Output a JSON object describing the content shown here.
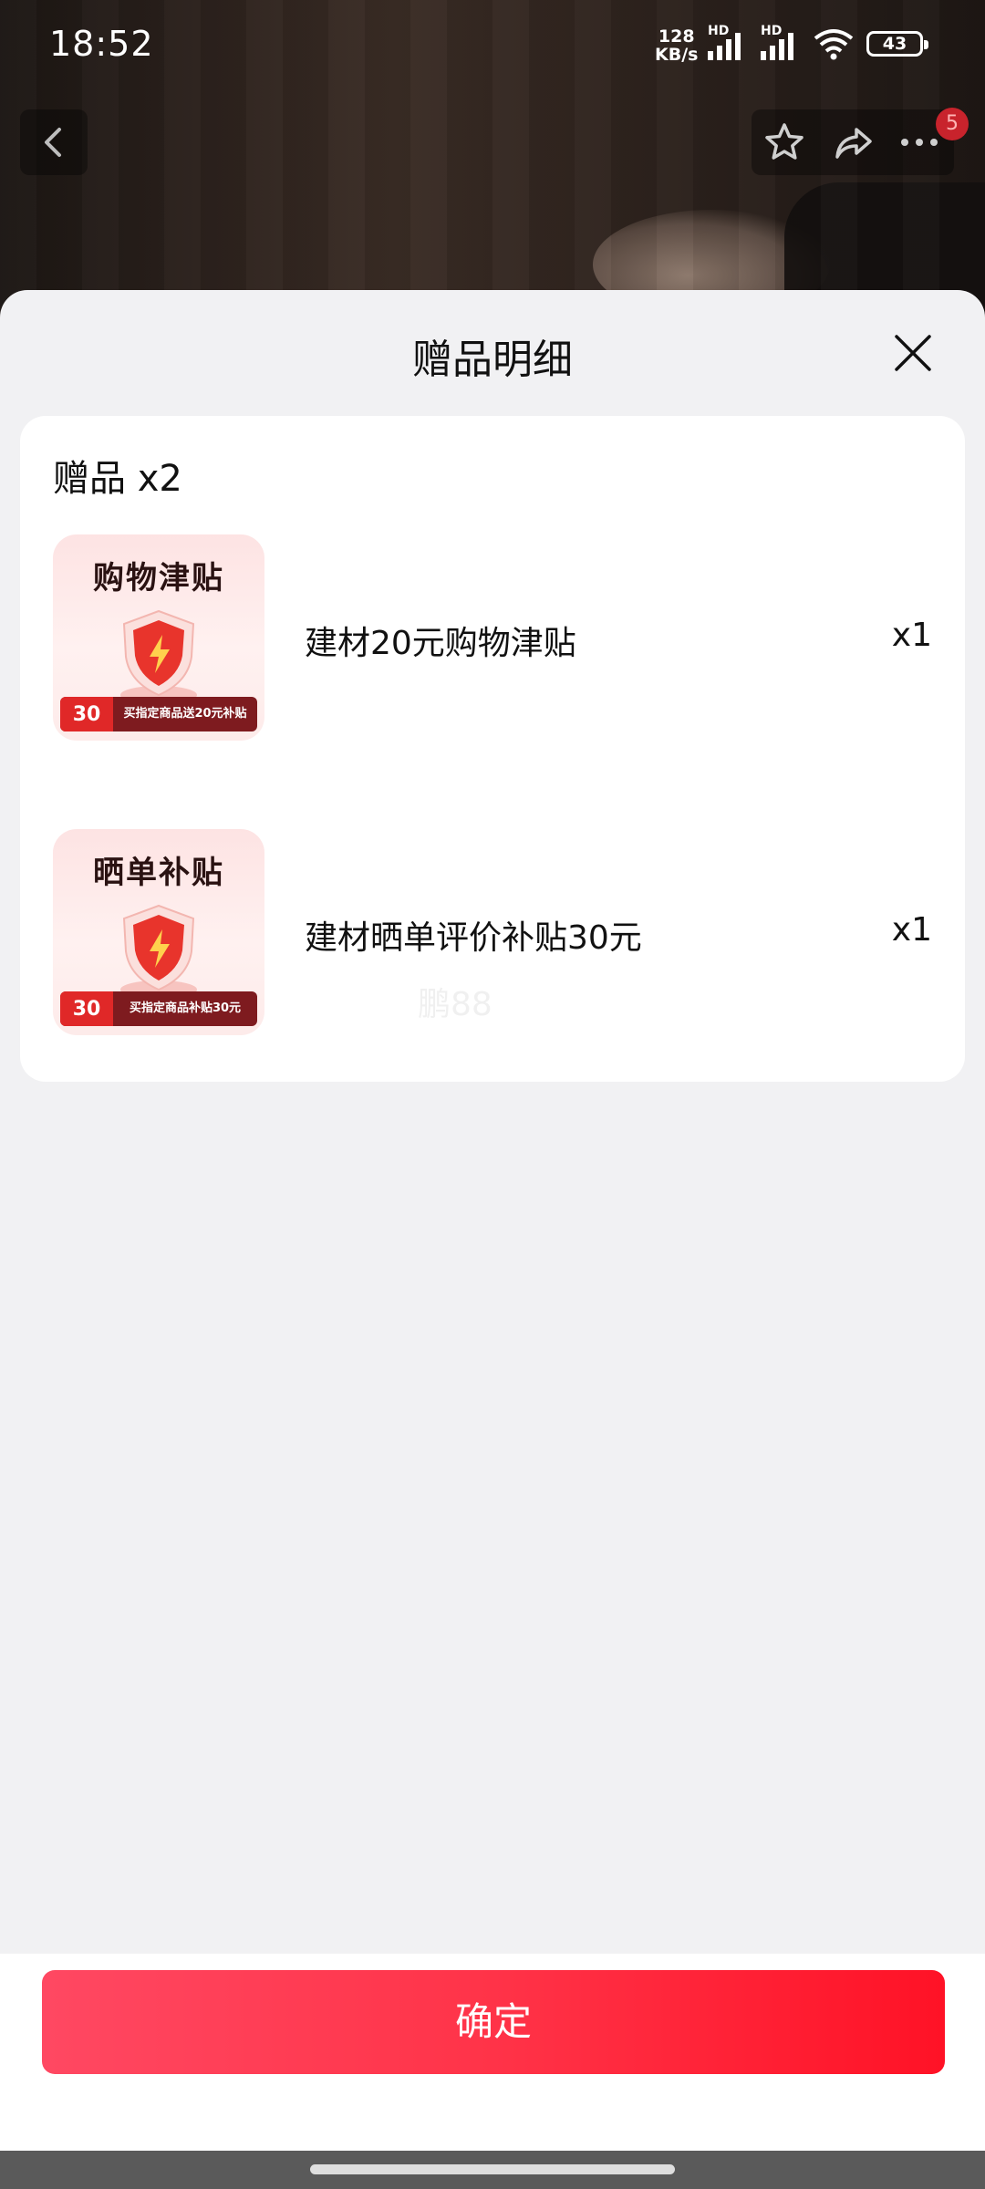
{
  "status_bar": {
    "time": "18:52",
    "net_speed_value": "128",
    "net_speed_unit": "KB/s",
    "sim1_tag": "HD",
    "sim2_tag": "HD",
    "battery": "43"
  },
  "nav": {
    "more_badge": "5"
  },
  "sheet": {
    "title": "赠品明细",
    "gift_count_label": "赠品 x2",
    "items": [
      {
        "name": "建材20元购物津贴",
        "qty": "x1",
        "thumb_title": "购物津贴",
        "thumb_tag": "30",
        "thumb_note": "买指定商品送20元补贴"
      },
      {
        "name": "建材晒单评价补贴30元",
        "qty": "x1",
        "thumb_title": "晒单补贴",
        "thumb_tag": "30",
        "thumb_note": "买指定商品补贴30元"
      }
    ],
    "watermark": "鹏88"
  },
  "footer": {
    "confirm_label": "确定"
  },
  "colors": {
    "accent": "#ff2d44",
    "sheet_bg": "#f1f1f3",
    "card_bg": "#ffffff"
  }
}
